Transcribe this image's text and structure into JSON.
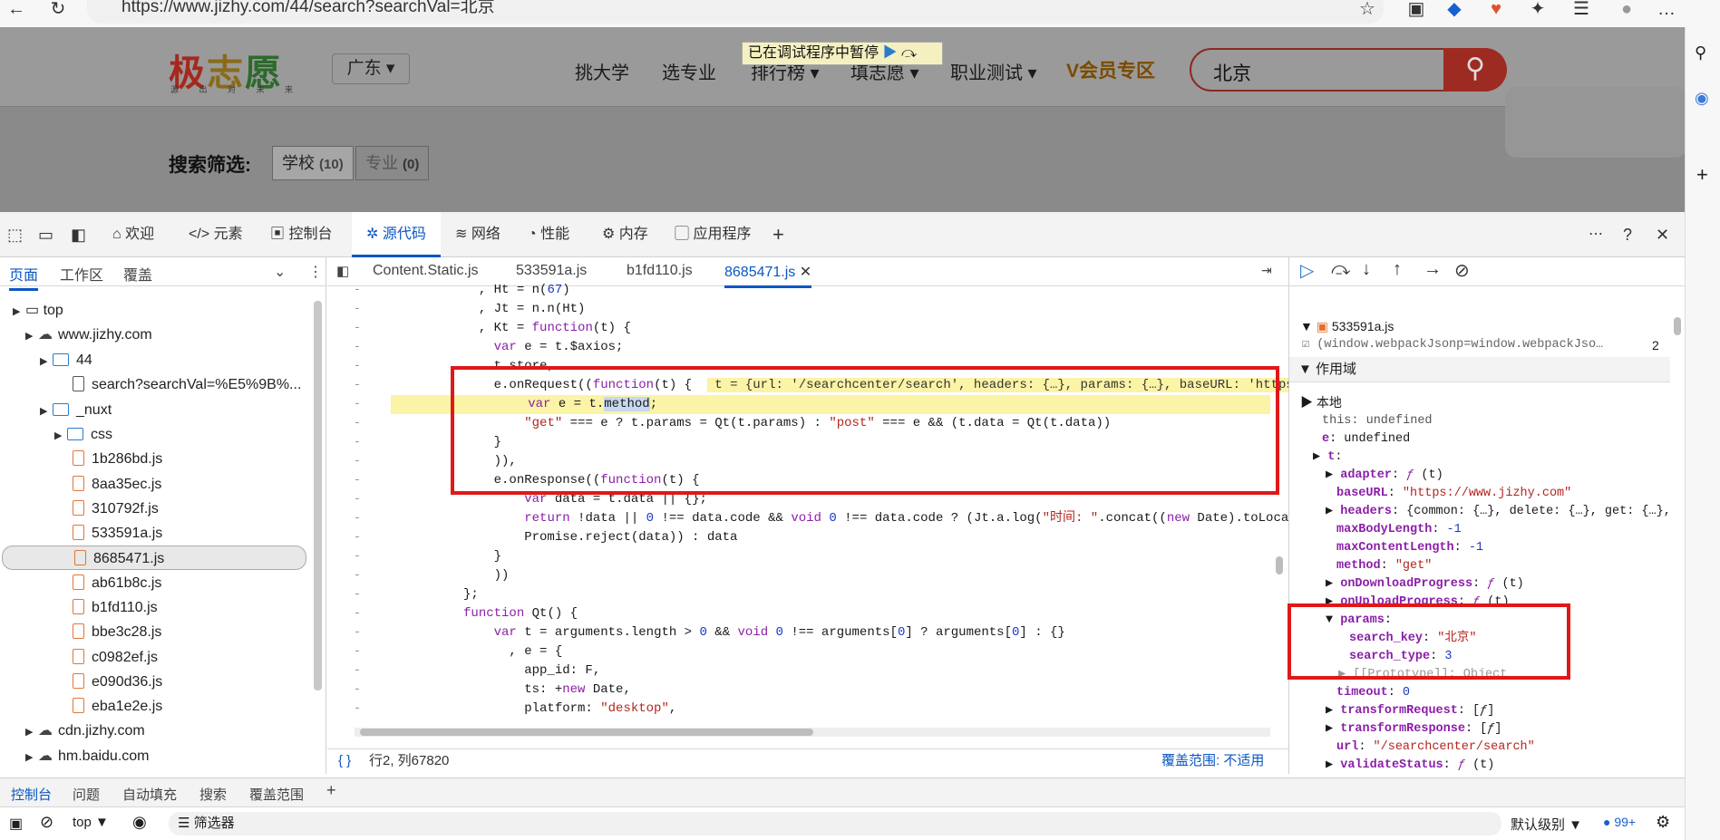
{
  "browser": {
    "url": "https://www.jizhy.com/44/search?searchVal=北京"
  },
  "site": {
    "logo": "极志愿",
    "logo_sub": "源 出 对 未 来",
    "region": "广东 ▾",
    "nav": [
      "挑大学",
      "选专业",
      "排行榜 ▾",
      "填志愿 ▾",
      "职业测试 ▾"
    ],
    "vip": "V会员专区",
    "search_value": "北京",
    "debug_banner": "已在调试程序中暂停",
    "filter_label": "搜索筛选:",
    "chips": [
      {
        "label": "学校",
        "count": "(10)"
      },
      {
        "label": "专业",
        "count": "(0)"
      }
    ]
  },
  "devtools": {
    "tabs": [
      "欢迎",
      "元素",
      "控制台",
      "源代码",
      "网络",
      "性能",
      "内存",
      "应用程序"
    ],
    "active_tab": "源代码",
    "left_tabs": [
      "页面",
      "工作区",
      "覆盖"
    ],
    "tree": [
      {
        "label": "top",
        "level": 0,
        "kind": "frame"
      },
      {
        "label": "www.jizhy.com",
        "level": 1,
        "kind": "cloud"
      },
      {
        "label": "44",
        "level": 2,
        "kind": "folder"
      },
      {
        "label": "search?searchVal=%E5%9B%...",
        "level": 3,
        "kind": "doc"
      },
      {
        "label": "_nuxt",
        "level": 2,
        "kind": "folder"
      },
      {
        "label": "css",
        "level": 3,
        "kind": "folder"
      },
      {
        "label": "1b286bd.js",
        "level": 3,
        "kind": "file"
      },
      {
        "label": "8aa35ec.js",
        "level": 3,
        "kind": "file"
      },
      {
        "label": "310792f.js",
        "level": 3,
        "kind": "file"
      },
      {
        "label": "533591a.js",
        "level": 3,
        "kind": "file"
      },
      {
        "label": "8685471.js",
        "level": 3,
        "kind": "file",
        "selected": true
      },
      {
        "label": "ab61b8c.js",
        "level": 3,
        "kind": "file"
      },
      {
        "label": "b1fd110.js",
        "level": 3,
        "kind": "file"
      },
      {
        "label": "bbe3c28.js",
        "level": 3,
        "kind": "file"
      },
      {
        "label": "c0982ef.js",
        "level": 3,
        "kind": "file"
      },
      {
        "label": "e090d36.js",
        "level": 3,
        "kind": "file"
      },
      {
        "label": "eba1e2e.js",
        "level": 3,
        "kind": "file"
      },
      {
        "label": "cdn.jizhy.com",
        "level": 1,
        "kind": "cloud"
      },
      {
        "label": "hm.baidu.com",
        "level": 1,
        "kind": "cloud"
      }
    ],
    "editor_tabs": [
      "Content.Static.js",
      "533591a.js",
      "b1fd110.js",
      "8685471.js"
    ],
    "status_pos": "行2, 列67820",
    "coverage": "覆盖范围: 不适用",
    "scope_label": "作用域",
    "local_label": "本地",
    "callstack_file": "533591a.js",
    "callstack_line": "(window.webpackJsonp=window.webpackJso…",
    "callstack_num": "2",
    "drawer_tabs": [
      "控制台",
      "问题",
      "自动填充",
      "搜索",
      "覆盖范围"
    ],
    "console": {
      "context": "top",
      "filter": "筛选器",
      "level": "默认级别",
      "badge": "99+"
    }
  }
}
